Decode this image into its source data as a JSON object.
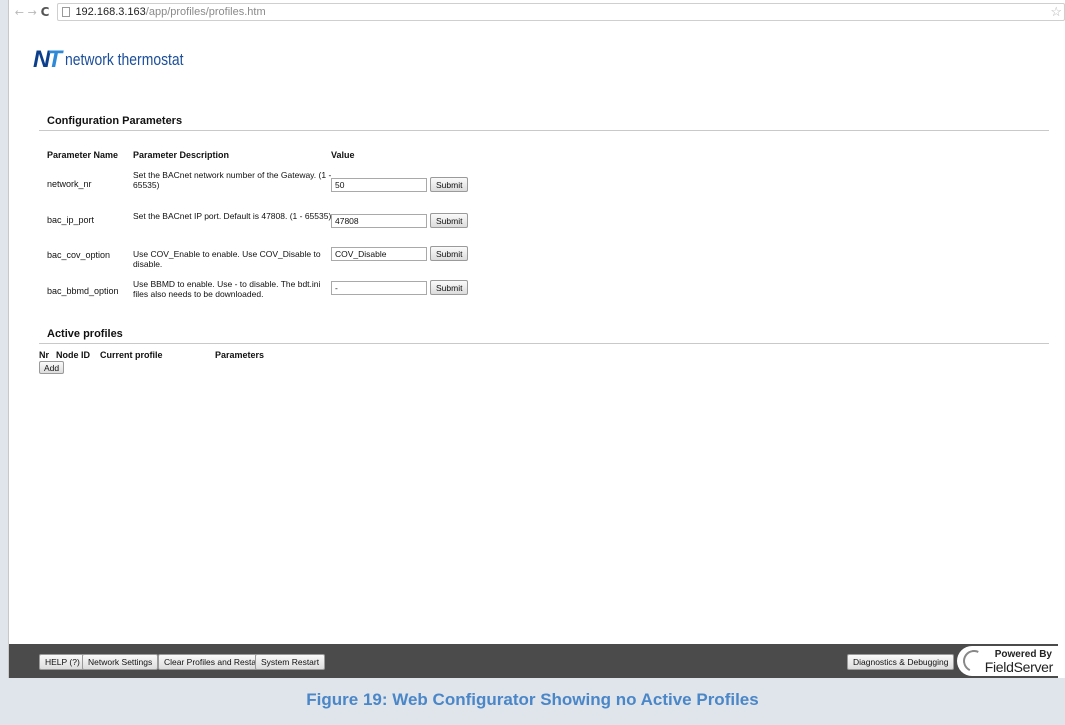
{
  "browser": {
    "url_host": "192.168.3.163",
    "url_path": "/app/profiles/profiles.htm"
  },
  "logo": {
    "mark": "NT",
    "text": "network thermostat"
  },
  "config": {
    "title": "Configuration Parameters",
    "headers": {
      "name": "Parameter Name",
      "description": "Parameter Description",
      "value": "Value"
    },
    "rows": [
      {
        "name": "network_nr",
        "description": "Set the BACnet network number of the Gateway. (1 - 65535)",
        "value": "50",
        "button": "Submit"
      },
      {
        "name": "bac_ip_port",
        "description": "Set the BACnet IP port. Default is 47808. (1 - 65535)",
        "value": "47808",
        "button": "Submit"
      },
      {
        "name": "bac_cov_option",
        "description": "Use COV_Enable to enable. Use COV_Disable to disable.",
        "value": "COV_Disable",
        "button": "Submit"
      },
      {
        "name": "bac_bbmd_option",
        "description": "Use BBMD to enable. Use - to disable. The bdt.ini files also needs to be downloaded.",
        "value": "-",
        "button": "Submit"
      }
    ]
  },
  "profiles": {
    "title": "Active profiles",
    "headers": {
      "nr": "Nr",
      "node_id": "Node ID",
      "current_profile": "Current profile",
      "parameters": "Parameters"
    },
    "add_label": "Add"
  },
  "footer": {
    "help": "HELP (?)",
    "network_settings": "Network Settings",
    "clear_restart": "Clear Profiles and Restart",
    "system_restart": "System Restart",
    "diagnostics": "Diagnostics & Debugging",
    "powered_by": "Powered By",
    "fieldserver": "FieldServer"
  },
  "caption": "Figure 19: Web Configurator Showing no Active Profiles",
  "colors": {
    "caption": "#4a86c8",
    "footer_bg": "#4b4b4b",
    "logo_blue": "#0b3f8c"
  }
}
